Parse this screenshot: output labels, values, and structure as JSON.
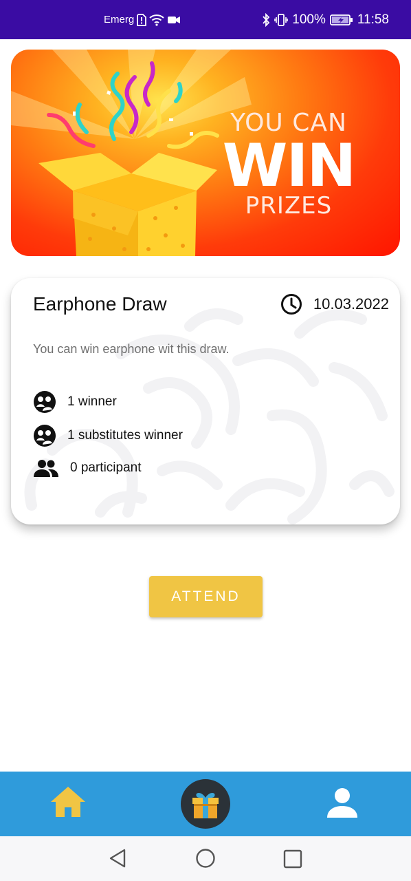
{
  "status_bar": {
    "carrier_text": "Emergency",
    "battery": "100%",
    "time": "11:58"
  },
  "banner": {
    "line1": "YOU CAN",
    "line2": "WIN",
    "line3": "PRIZES"
  },
  "draw": {
    "title": "Earphone Draw",
    "date": "10.03.2022",
    "description": "You can win earphone wit this draw.",
    "winners": "1 winner",
    "substitutes": "1 substitutes winner",
    "participants": "0 participant"
  },
  "actions": {
    "attend_label": "ATTEND"
  },
  "bottom_nav": {
    "items": [
      {
        "icon": "home-icon",
        "color": "#f0c544"
      },
      {
        "icon": "gift-icon",
        "color": "#2b3238"
      },
      {
        "icon": "profile-icon",
        "color": "#ffffff"
      }
    ],
    "background": "#2f9bdb"
  },
  "colors": {
    "status_bar": "#3a0ca3",
    "accent": "#f0c544"
  }
}
